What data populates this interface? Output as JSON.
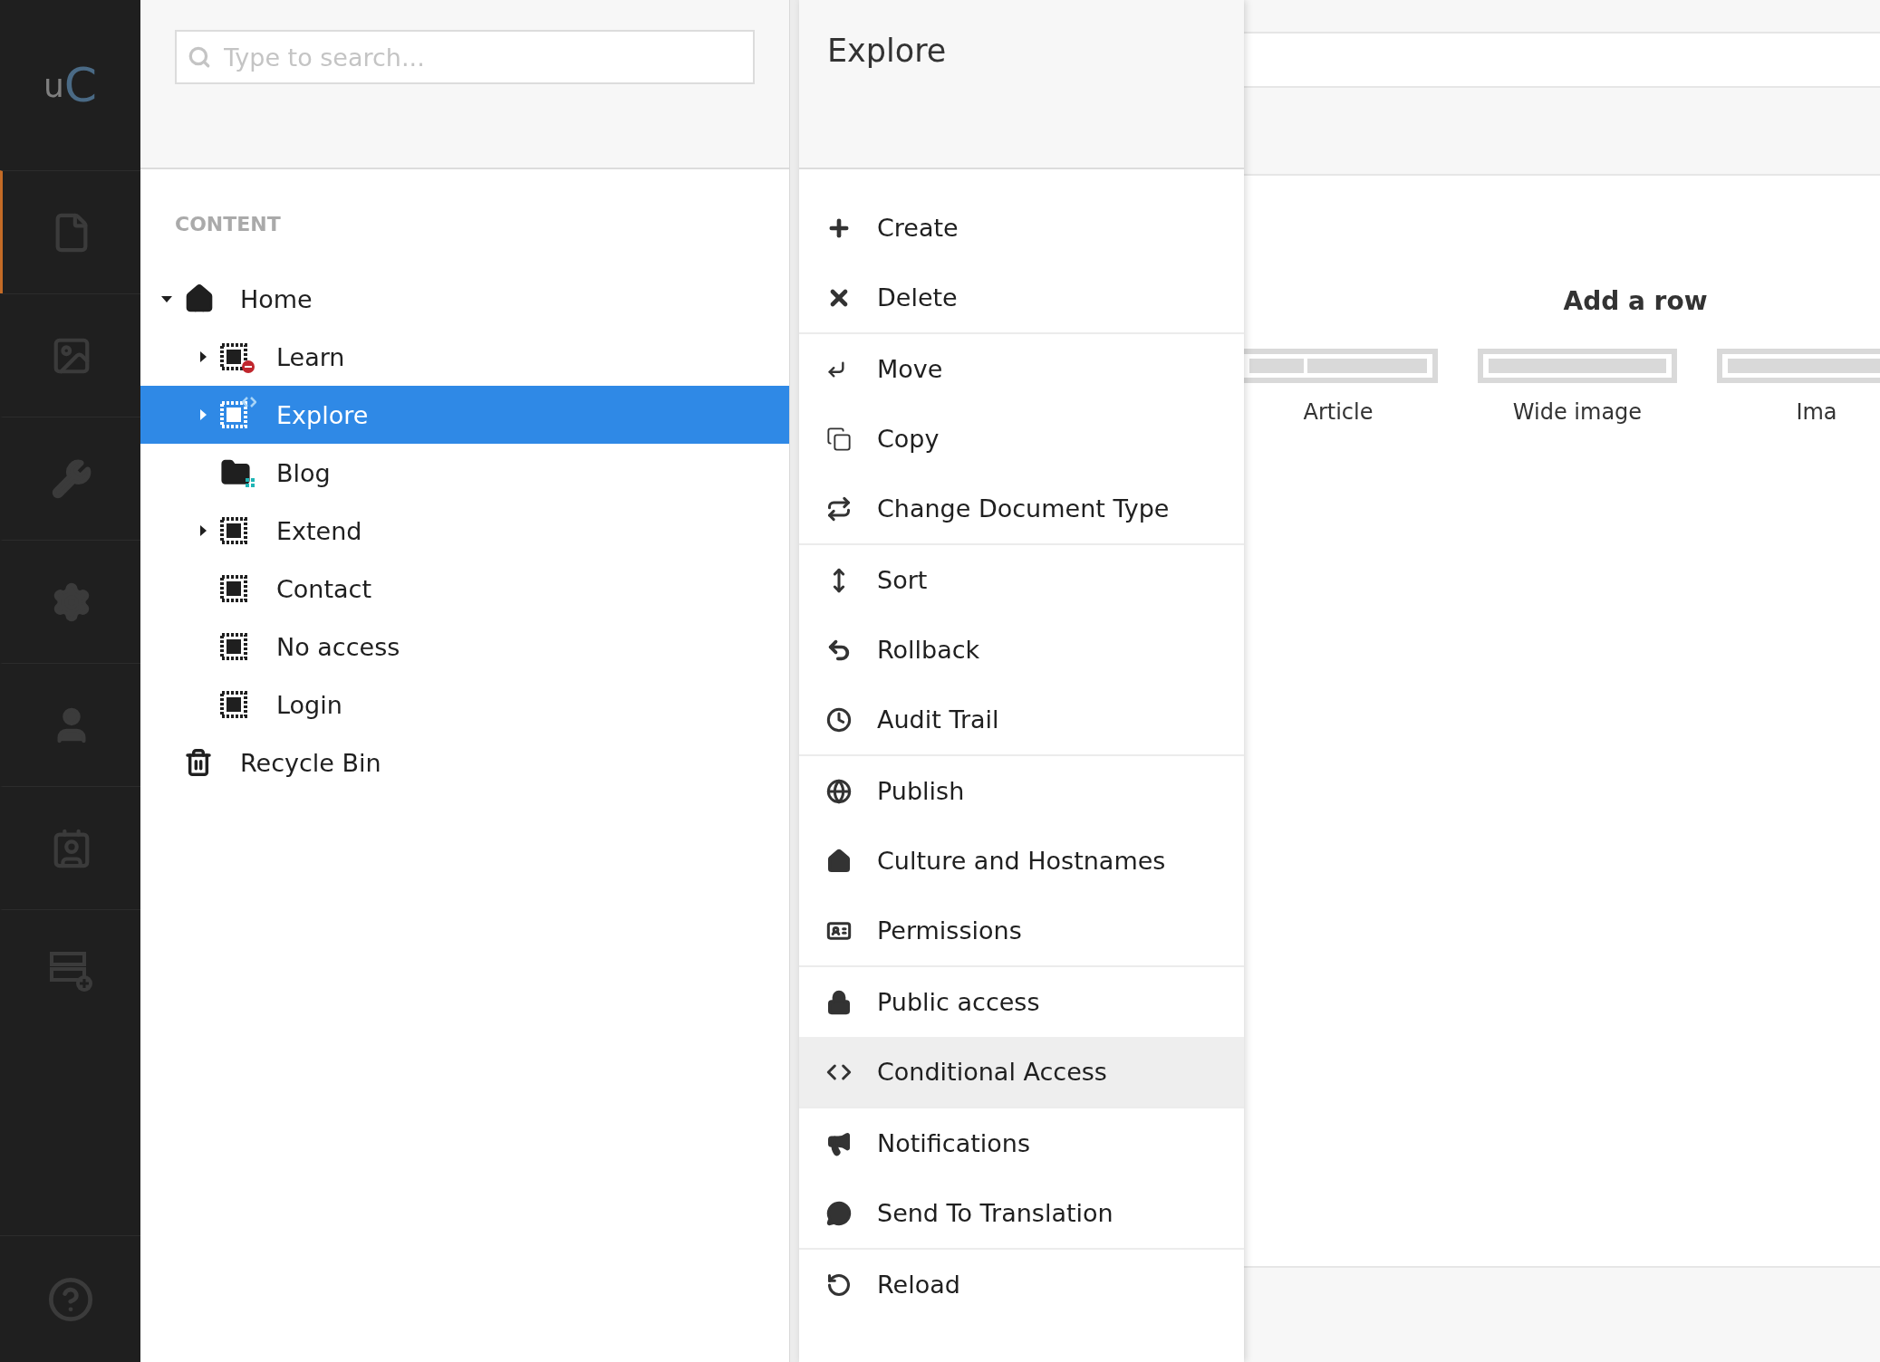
{
  "logo": {
    "letters": [
      "u",
      "C"
    ]
  },
  "sections": [
    {
      "kind": "content",
      "selected": true
    },
    {
      "kind": "media",
      "selected": false
    },
    {
      "kind": "settings-tools",
      "selected": false
    },
    {
      "kind": "packages",
      "selected": false
    },
    {
      "kind": "users",
      "selected": false
    },
    {
      "kind": "members",
      "selected": false
    },
    {
      "kind": "forms",
      "selected": false
    }
  ],
  "help": {
    "kind": "help"
  },
  "search": {
    "placeholder": "Type to search..."
  },
  "tree": {
    "heading": "CONTENT",
    "items": [
      {
        "label": "Home",
        "kind": "home",
        "has_children": true,
        "expanded": true,
        "selected": false,
        "children": [
          {
            "label": "Learn",
            "kind": "document-restricted",
            "has_children": true,
            "expanded": false,
            "selected": false
          },
          {
            "label": "Explore",
            "kind": "document-conditional",
            "has_children": true,
            "expanded": false,
            "selected": true
          },
          {
            "label": "Blog",
            "kind": "folder-list",
            "has_children": false,
            "expanded": false,
            "selected": false
          },
          {
            "label": "Extend",
            "kind": "document",
            "has_children": true,
            "expanded": false,
            "selected": false
          },
          {
            "label": "Contact",
            "kind": "document",
            "has_children": false,
            "expanded": false,
            "selected": false
          },
          {
            "label": "No access",
            "kind": "document",
            "has_children": false,
            "expanded": false,
            "selected": false
          },
          {
            "label": "Login",
            "kind": "document",
            "has_children": false,
            "expanded": false,
            "selected": false
          }
        ]
      },
      {
        "label": "Recycle Bin",
        "kind": "trash",
        "has_children": false,
        "expanded": false,
        "selected": false
      }
    ]
  },
  "actions_menu": {
    "title": "Explore",
    "groups": [
      [
        {
          "label": "Create",
          "kind": "plus",
          "hovered": false
        },
        {
          "label": "Delete",
          "kind": "x",
          "hovered": false
        }
      ],
      [
        {
          "label": "Move",
          "kind": "move",
          "hovered": false
        },
        {
          "label": "Copy",
          "kind": "copy",
          "hovered": false
        },
        {
          "label": "Change Document Type",
          "kind": "swap",
          "hovered": false
        }
      ],
      [
        {
          "label": "Sort",
          "kind": "sort",
          "hovered": false
        },
        {
          "label": "Rollback",
          "kind": "undo",
          "hovered": false
        },
        {
          "label": "Audit Trail",
          "kind": "clock",
          "hovered": false
        }
      ],
      [
        {
          "label": "Publish",
          "kind": "globe",
          "hovered": false
        },
        {
          "label": "Culture and Hostnames",
          "kind": "home",
          "hovered": false
        },
        {
          "label": "Permissions",
          "kind": "idcard",
          "hovered": false
        }
      ],
      [
        {
          "label": "Public access",
          "kind": "lock",
          "hovered": false
        },
        {
          "label": "Conditional Access",
          "kind": "code",
          "hovered": true
        }
      ],
      [
        {
          "label": "Notifications",
          "kind": "megaphone",
          "hovered": false
        },
        {
          "label": "Send To Translation",
          "kind": "bubble",
          "hovered": false
        }
      ],
      [
        {
          "label": "Reload",
          "kind": "reload",
          "hovered": false
        }
      ]
    ]
  },
  "editor": {
    "heading": "Add a row",
    "layouts": [
      {
        "label": "Article",
        "kind": "two-column"
      },
      {
        "label": "Wide image",
        "kind": "full-width"
      },
      {
        "label": "Ima",
        "kind": "full-width"
      }
    ]
  }
}
